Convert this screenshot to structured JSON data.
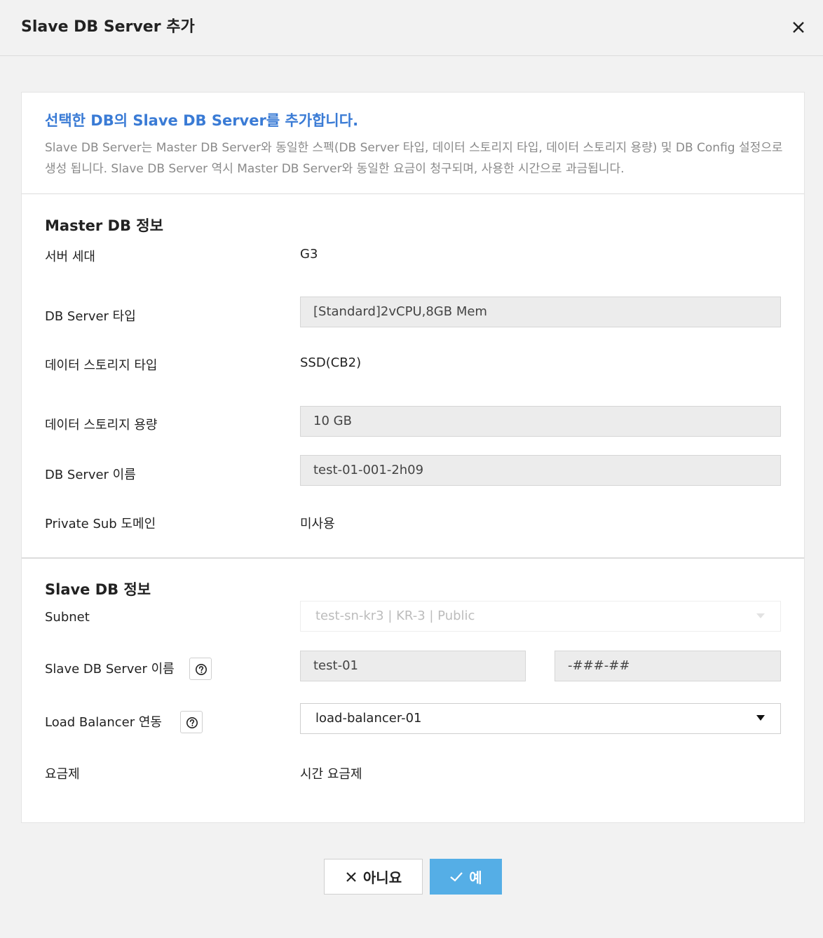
{
  "dialog": {
    "title": "Slave DB Server 추가"
  },
  "intro": {
    "title": "선택한 DB의 Slave DB Server를 추가합니다.",
    "description": "Slave DB Server는 Master DB Server와 동일한 스펙(DB Server 타입, 데이터 스토리지 타입, 데이터 스토리지 용량) 및 DB Config 설정으로 생성 됩니다. Slave DB Server 역시 Master DB Server와 동일한 요금이 청구되며, 사용한 시간으로 과금됩니다."
  },
  "master": {
    "title": "Master DB 정보",
    "server_gen_label": "서버 세대",
    "server_gen_value": "G3",
    "server_type_label": "DB Server 타입",
    "server_type_value": "[Standard]2vCPU,8GB Mem",
    "storage_type_label": "데이터 스토리지 타입",
    "storage_type_value": "SSD(CB2)",
    "storage_size_label": "데이터 스토리지 용량",
    "storage_size_value": "10 GB",
    "server_name_label": "DB Server 이름",
    "server_name_value": "test-01-001-2h09",
    "private_domain_label": "Private Sub 도메인",
    "private_domain_value": "미사용"
  },
  "slave": {
    "title": "Slave DB 정보",
    "subnet_label": "Subnet",
    "subnet_value": "test-sn-kr3 | KR-3 | Public",
    "name_label": "Slave DB Server 이름",
    "name_prefix": "test-01",
    "name_suffix": "-###-##",
    "lb_label": "Load Balancer 연동",
    "lb_value": "load-balancer-01",
    "pricing_label": "요금제",
    "pricing_value": "시간 요금제"
  },
  "buttons": {
    "no_label": "아니요",
    "yes_label": "예"
  },
  "colors": {
    "accent_blue": "#3a7bd5",
    "confirm_button": "#55aee6"
  }
}
